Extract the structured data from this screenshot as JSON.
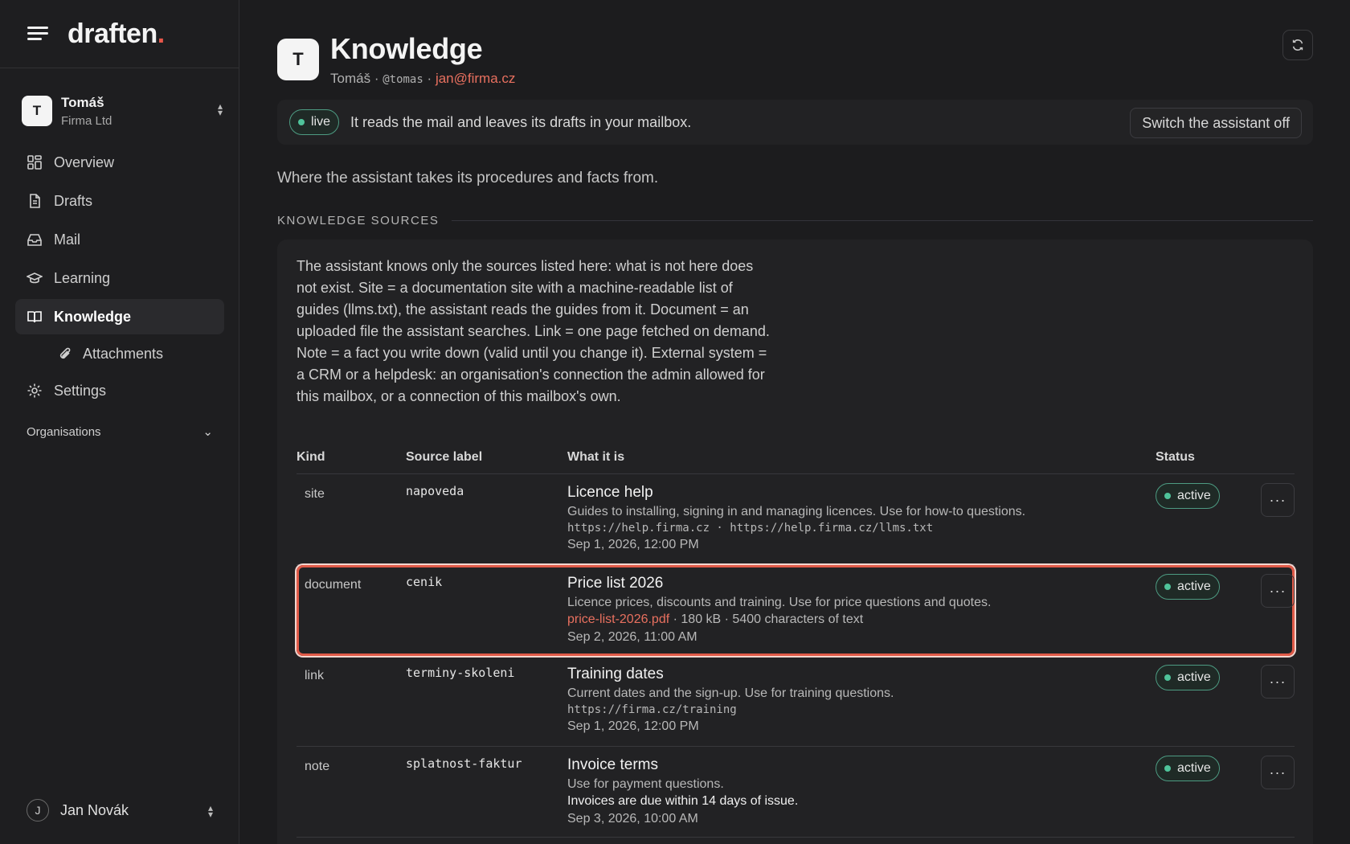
{
  "app": {
    "logo_text": "draften",
    "logo_dot": ".",
    "accent_color": "#e8574a"
  },
  "sidebar": {
    "account": {
      "initial": "T",
      "name": "Tomáš",
      "org": "Firma Ltd"
    },
    "items": [
      {
        "label": "Overview",
        "icon": "grid-icon"
      },
      {
        "label": "Drafts",
        "icon": "document-icon"
      },
      {
        "label": "Mail",
        "icon": "inbox-icon"
      },
      {
        "label": "Learning",
        "icon": "graduation-cap-icon"
      },
      {
        "label": "Knowledge",
        "icon": "book-icon",
        "active": true
      },
      {
        "label": "Attachments",
        "icon": "paperclip-icon",
        "sub": true
      },
      {
        "label": "Settings",
        "icon": "gear-icon"
      }
    ],
    "organisations_label": "Organisations",
    "user": {
      "initial": "J",
      "name": "Jan Novák"
    }
  },
  "header": {
    "initial": "T",
    "title": "Knowledge",
    "sub_name": "Tomáš",
    "sub_sep": "·",
    "sub_handle": "@tomas",
    "sub_email": "jan@firma.cz"
  },
  "live_bar": {
    "badge": "live",
    "text": "It reads the mail and leaves its drafts in your mailbox.",
    "switch_button": "Switch the assistant off"
  },
  "intro": "Where the assistant takes its procedures and facts from.",
  "section_title": "KNOWLEDGE SOURCES",
  "card_description": "The assistant knows only the sources listed here: what is not here does not exist. Site = a documentation site with a machine-readable list of guides (llms.txt), the assistant reads the guides from it. Document = an uploaded file the assistant searches. Link = one page fetched on demand. Note = a fact you write down (valid until you change it). External system = a CRM or a helpdesk: an organisation's connection the admin allowed for this mailbox, or a connection of this mailbox's own.",
  "table": {
    "headers": {
      "kind": "Kind",
      "label": "Source label",
      "what": "What it is",
      "status": "Status"
    },
    "rows": [
      {
        "kind": "site",
        "label": "napoveda",
        "title": "Licence help",
        "desc": "Guides to installing, signing in and managing licences. Use for how-to questions.",
        "mono": "https://help.firma.cz · https://help.firma.cz/llms.txt",
        "date": "Sep 1, 2026, 12:00 PM",
        "status": "active"
      },
      {
        "kind": "document",
        "label": "cenik",
        "title": "Price list 2026",
        "desc": "Licence prices, discounts and training. Use for price questions and quotes.",
        "file": "price-list-2026.pdf",
        "file_meta": " · 180 kB · 5400 characters of text",
        "date": "Sep 2, 2026, 11:00 AM",
        "status": "active",
        "selected": true
      },
      {
        "kind": "link",
        "label": "terminy-skoleni",
        "title": "Training dates",
        "desc": "Current dates and the sign-up. Use for training questions.",
        "mono": "https://firma.cz/training",
        "date": "Sep 1, 2026, 12:00 PM",
        "status": "active"
      },
      {
        "kind": "note",
        "label": "splatnost-faktur",
        "title": "Invoice terms",
        "desc": "Use for payment questions.",
        "note": "Invoices are due within 14 days of issue.",
        "date": "Sep 3, 2026, 10:00 AM",
        "status": "active"
      }
    ],
    "more_label": "···"
  },
  "colors": {
    "status_active": "#4fc39a",
    "link": "#e8705f",
    "selection_outline": "#e05a48"
  }
}
